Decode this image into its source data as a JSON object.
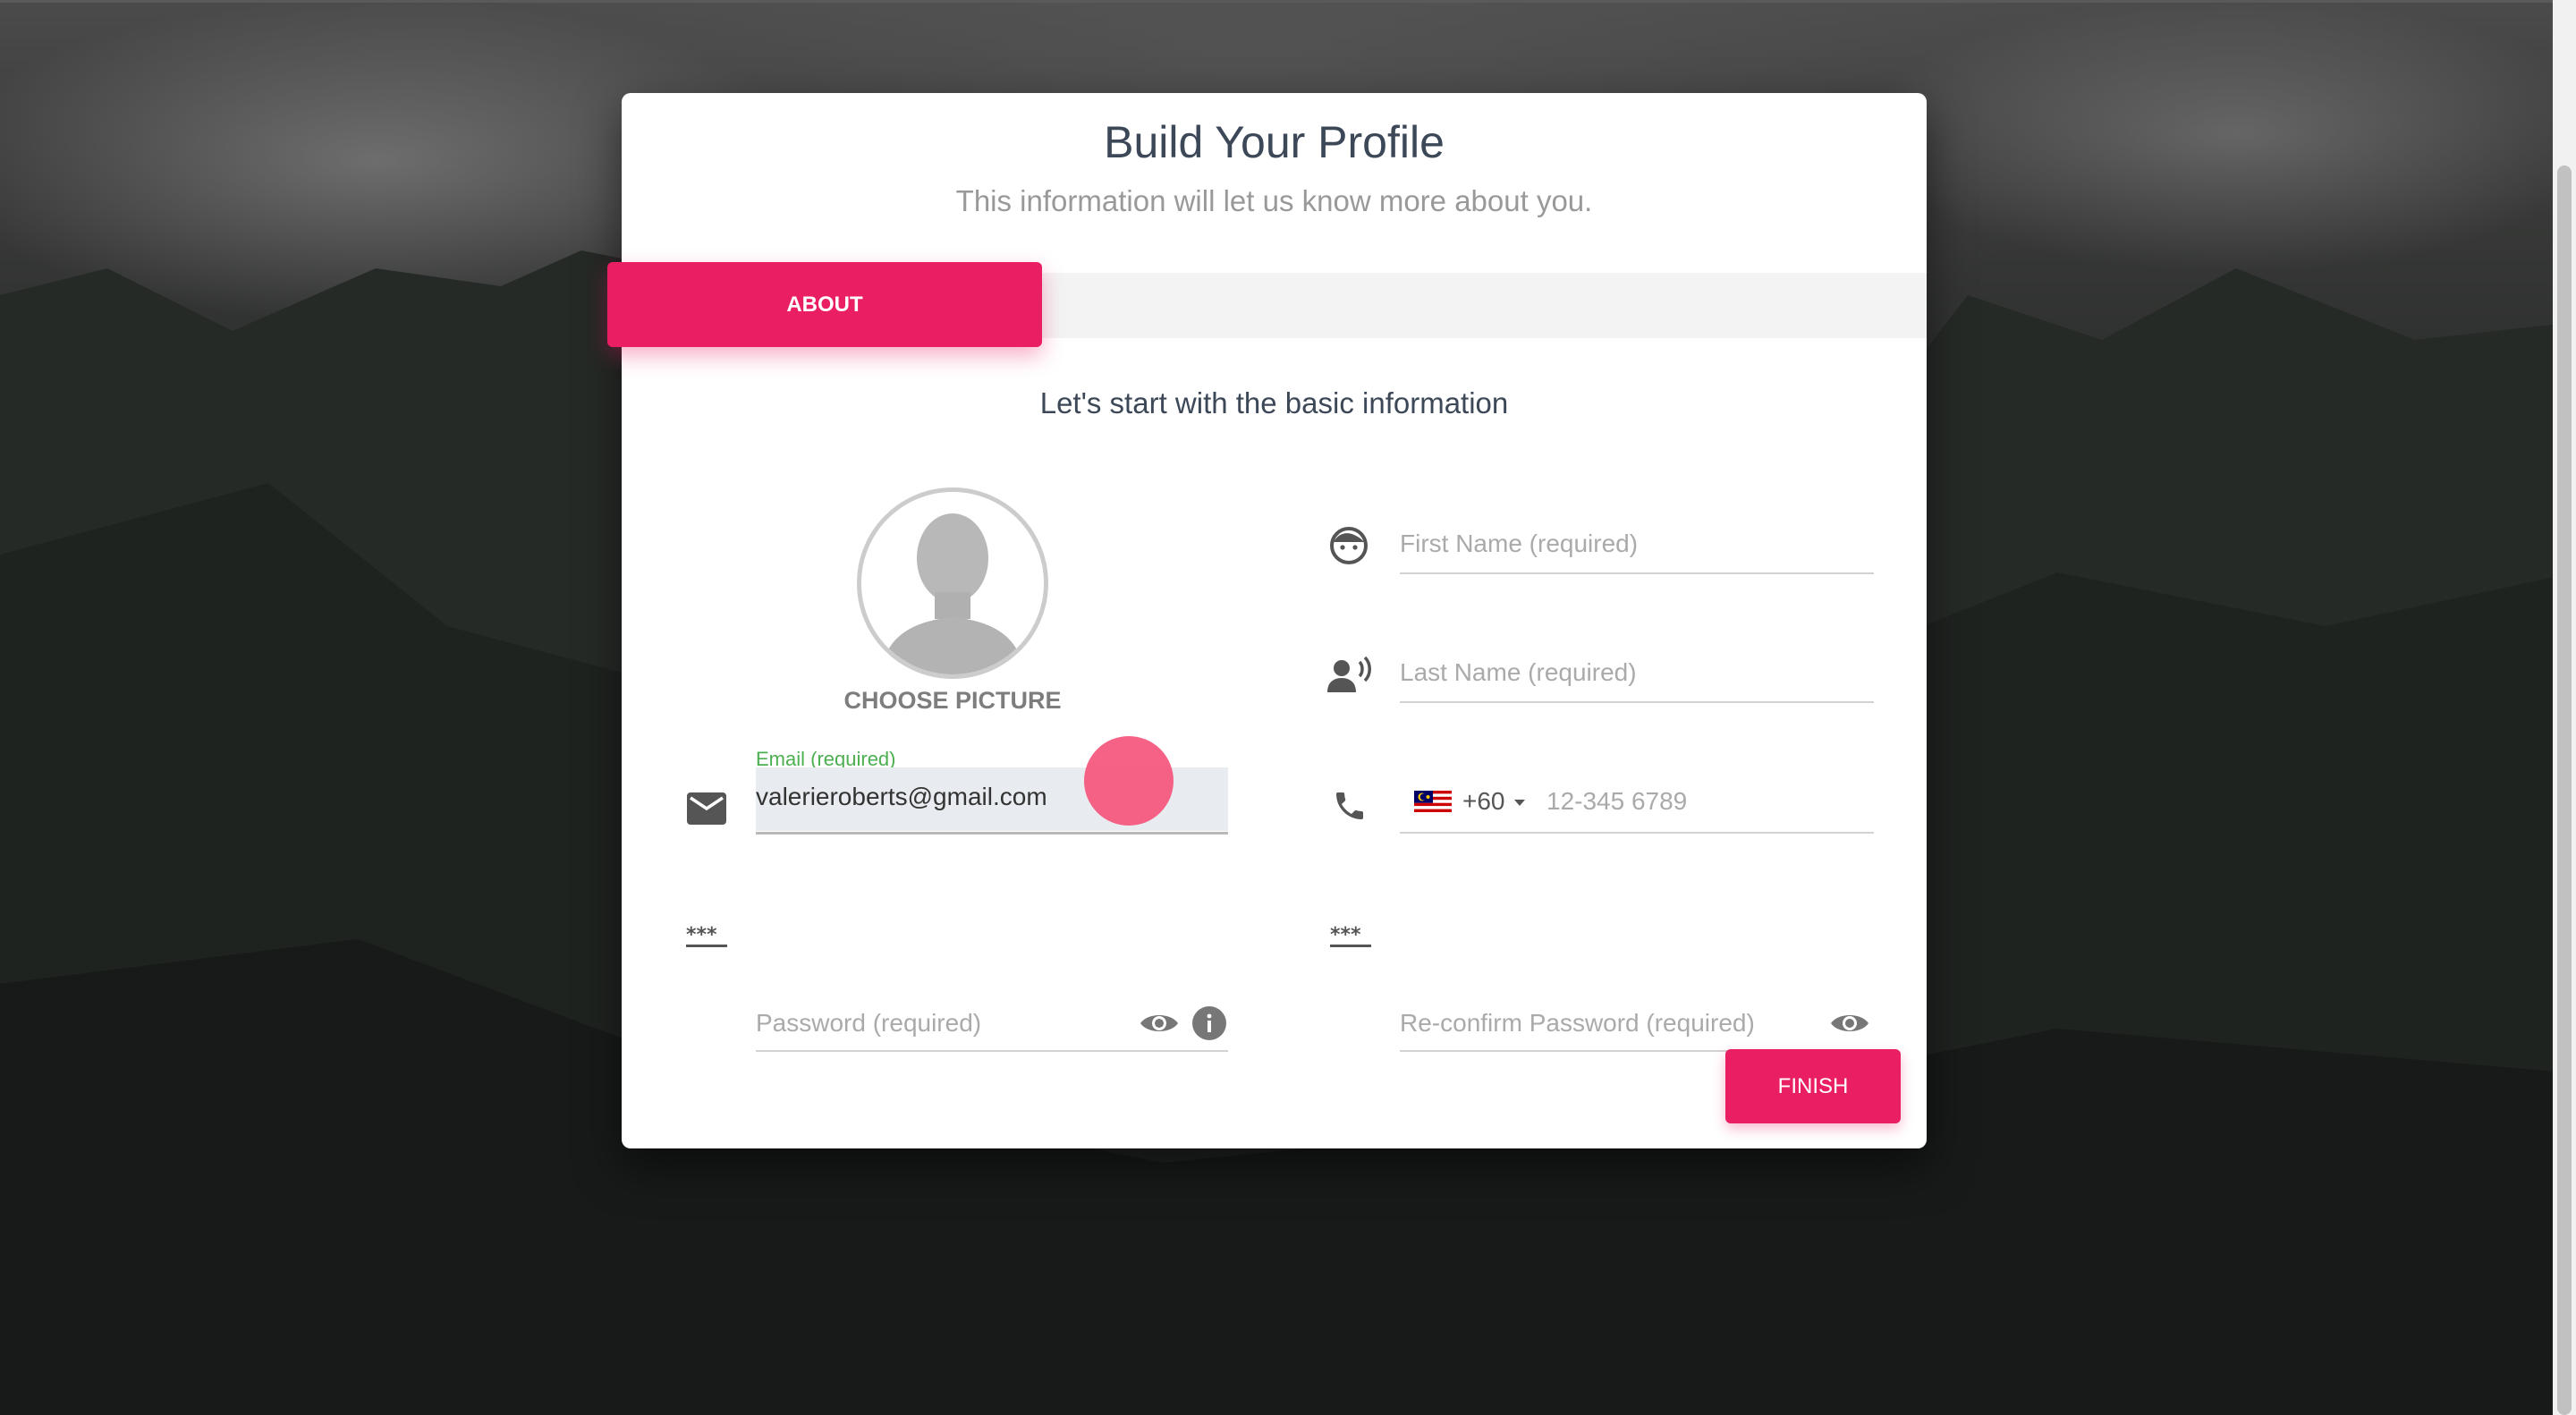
{
  "header": {
    "title": "Build Your Profile",
    "subtitle": "This information will let us know more about you."
  },
  "tabs": [
    {
      "label": "ABOUT",
      "active": true
    }
  ],
  "section": {
    "title": "Let's start with the basic information"
  },
  "avatar": {
    "choose_label": "CHOOSE PICTURE"
  },
  "form": {
    "first_name": {
      "placeholder": "First Name (required)",
      "value": ""
    },
    "last_name": {
      "placeholder": "Last Name (required)",
      "value": ""
    },
    "email": {
      "label": "Email (required)",
      "value": "valerieroberts@gmail.com"
    },
    "phone": {
      "country_code": "+60",
      "placeholder": "12-345 6789",
      "value": ""
    },
    "password": {
      "placeholder": "Password (required)",
      "value": ""
    },
    "reconfirm_password": {
      "placeholder": "Re-confirm Password (required)",
      "value": ""
    }
  },
  "actions": {
    "finish_label": "FINISH"
  },
  "icons": {
    "first_name": "face-icon",
    "last_name": "voice-person-icon",
    "email": "mail-icon",
    "phone": "phone-icon",
    "password": "password-icon",
    "show_password": "eye-icon",
    "password_info": "info-icon",
    "country_flag": "malaysia-flag-icon",
    "dropdown": "caret-down-icon"
  },
  "colors": {
    "accent": "#e91e63",
    "success_label": "#4caf50",
    "text": "#3c4858",
    "muted": "#999999"
  }
}
